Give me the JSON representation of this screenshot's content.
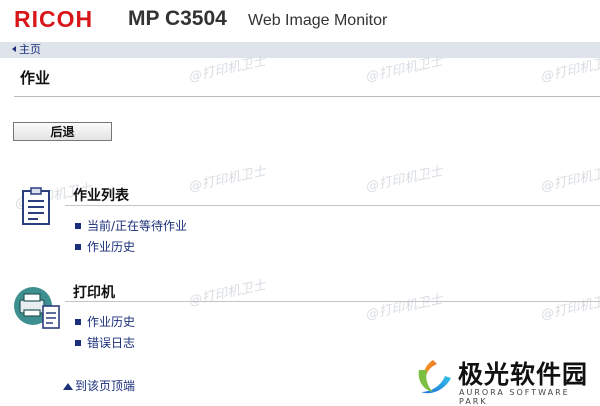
{
  "header": {
    "brand": "RICOH",
    "model": "MP C3504",
    "product": "Web Image Monitor"
  },
  "nav": {
    "home_label": "主页"
  },
  "page": {
    "title": "作业",
    "back_button": "后退"
  },
  "sections": [
    {
      "title": "作业列表",
      "icon": "job-list-icon",
      "links": [
        "当前/正在等待作业",
        "作业历史"
      ]
    },
    {
      "title": "打印机",
      "icon": "printer-icon",
      "links": [
        "作业历史",
        "错误日志"
      ]
    }
  ],
  "footer": {
    "top_link": "到该页顶端"
  },
  "watermark": {
    "text": "@打印机卫士"
  },
  "overlay_logo": {
    "name": "极光软件园",
    "english": "AURORA SOFTWARE PARK"
  },
  "colors": {
    "brand_red": "#d8161a",
    "link_blue": "#1b2f7a",
    "nav_bar": "#dfe4ea"
  }
}
